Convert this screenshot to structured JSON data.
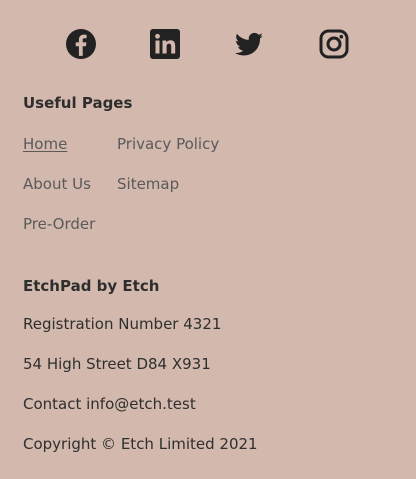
{
  "social": {
    "icons": [
      "facebook-icon",
      "linkedin-icon",
      "twitter-icon",
      "instagram-icon"
    ]
  },
  "useful_pages": {
    "title": "Useful Pages",
    "links": [
      "Home",
      "Privacy Policy",
      "About Us",
      "Sitemap",
      "Pre-Order"
    ],
    "active": "Home"
  },
  "company": {
    "title": "EtchPad by Etch",
    "registration": "Registration Number 4321",
    "address": "54 High Street D84 X931",
    "contact": "Contact info@etch.test",
    "copyright": "Copyright © Etch Limited 2021"
  },
  "colors": {
    "background": "#d2b8ad",
    "icon": "#222222",
    "link": "#5a5a5a",
    "text": "#2f2f2f"
  }
}
